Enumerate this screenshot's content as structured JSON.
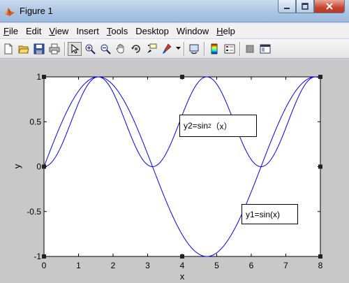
{
  "window": {
    "title": "Figure 1",
    "icon": "matlab-icon"
  },
  "menu": [
    {
      "label": "File",
      "accel": "F",
      "rest": "ile"
    },
    {
      "label": "Edit",
      "accel": "",
      "rest": "Edit"
    },
    {
      "label": "View",
      "accel": "V",
      "rest": "iew"
    },
    {
      "label": "Insert",
      "accel": "",
      "rest": "Insert"
    },
    {
      "label": "Tools",
      "accel": "T",
      "rest": "ools"
    },
    {
      "label": "Desktop",
      "accel": "",
      "rest": "Desktop"
    },
    {
      "label": "Window",
      "accel": "",
      "rest": "Window"
    },
    {
      "label": "Help",
      "accel": "H",
      "rest": "elp"
    }
  ],
  "toolbar": [
    "new-figure-icon",
    "open-file-icon",
    "save-icon",
    "print-icon",
    "select-arrow-icon",
    "zoom-in-icon",
    "zoom-out-icon",
    "pan-hand-icon",
    "rotate-3d-icon",
    "data-cursor-icon",
    "brush-icon",
    "link-plot-icon",
    "colorbar-icon",
    "legend-icon",
    "hide-plot-tools-icon",
    "show-plot-tools-icon"
  ],
  "chart_data": {
    "type": "line",
    "xlabel": "x",
    "ylabel": "y",
    "xlim": [
      0,
      8
    ],
    "ylim": [
      -1,
      1
    ],
    "xticks": [
      "0",
      "1",
      "2",
      "3",
      "4",
      "5",
      "6",
      "7",
      "8"
    ],
    "yticks": [
      "-1",
      "-0.5",
      "0",
      "0.5",
      "1"
    ],
    "series": [
      {
        "name": "y1=sin(x)",
        "function": "sin",
        "color": "#0000ff"
      },
      {
        "name": "y2=sin2(x)",
        "function": "sin_squared",
        "color": "#0000ff"
      }
    ],
    "annotations": {
      "y2_prefix": "y2=sin",
      "y2_sup": "2",
      "y2_suffix": "（x）",
      "y1": "y1=sin(x)"
    }
  }
}
